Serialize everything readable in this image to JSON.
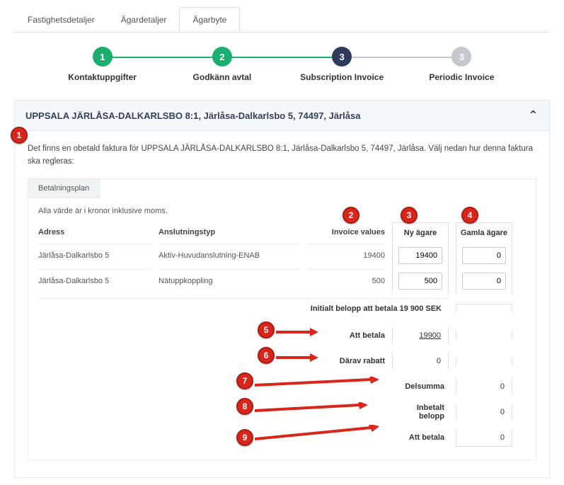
{
  "tabs": {
    "t1": "Fastighetsdetaljer",
    "t2": "Ägardetaljer",
    "t3": "Ägarbyte"
  },
  "steps": {
    "s1_num": "1",
    "s1_label": "Kontaktuppgifter",
    "s2_num": "2",
    "s2_label": "Godkänn avtal",
    "s3_num": "3",
    "s3_label": "Subscription Invoice",
    "s4_num": "3",
    "s4_label": "Periodic Invoice"
  },
  "accordion": {
    "title": "UPPSALA JÄRLÅSA-DALKARLSBO 8:1, Järlåsa-Dalkarlsbo 5, 74497, Järlåsa"
  },
  "intro": "Det finns en obetald faktura för UPPSALA JÄRLÅSA-DALKARLSBO 8:1, Järlåsa-Dalkarlsbo 5, 74497, Järlåsa. Välj nedan hur denna faktura ska regleras:",
  "subtab": "Betalningsplan",
  "note": "Alla värde är i kronor inklusive moms.",
  "headers": {
    "address": "Adress",
    "conn": "Anslutningstyp",
    "invoice": "Invoice values",
    "new_owner": "Ny ägare",
    "old_owner": "Gamla ägare"
  },
  "rows": [
    {
      "address": "Järlåsa-Dalkarlsbo 5",
      "conn": "Aktiv-Huvudanslutning-ENAB",
      "invoice": "19400",
      "new_owner": "19400",
      "old_owner": "0"
    },
    {
      "address": "Järlåsa-Dalkarlsbo 5",
      "conn": "Nätuppkoppling",
      "invoice": "500",
      "new_owner": "500",
      "old_owner": "0"
    }
  ],
  "initial_label": "Initialt belopp att betala 19 900 SEK",
  "summary": {
    "att_betala_label": "Att betala",
    "att_betala_v1": "19900",
    "darav_label": "Därav rabatt",
    "darav_v1": "0",
    "delsumma_label": "Delsumma",
    "delsumma_v2": "0",
    "inbetalt_label": "Inbetalt belopp",
    "inbetalt_v2": "0",
    "att_betala2_label": "Att betala",
    "att_betala2_v2": "0"
  },
  "badges": {
    "b1": "1",
    "b2": "2",
    "b3": "3",
    "b4": "4",
    "b5": "5",
    "b6": "6",
    "b7": "7",
    "b8": "8",
    "b9": "9"
  }
}
